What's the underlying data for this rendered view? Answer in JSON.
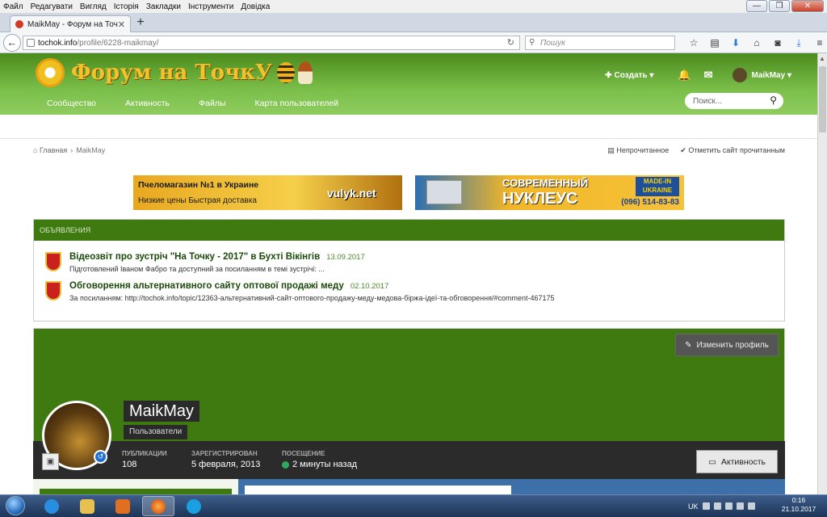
{
  "menubar": {
    "items": [
      "Файл",
      "Редагувати",
      "Вигляд",
      "Історія",
      "Закладки",
      "Інструменти",
      "Довідка"
    ]
  },
  "browser": {
    "tab_title": "MaikMay - Форум на ТочкУ",
    "url_domain": "tochok.info",
    "url_path": "/profile/6228-maikmay/",
    "search_placeholder": "Пошук"
  },
  "site": {
    "logo_text": "Форум на ТочкУ",
    "create_label": "Создать",
    "user_name": "MaikMay",
    "nav": [
      "Сообщество",
      "Активность",
      "Файлы",
      "Карта пользователей"
    ],
    "search_placeholder": "Поиск..."
  },
  "breadcrumb": {
    "home": "Главная",
    "current": "MaikMay",
    "unread": "Непрочитанное",
    "mark_read": "Отметить сайт прочитанным"
  },
  "banners": {
    "left_line1": "Пчеломагазин №1 в Украине",
    "left_line2": "Низкие цены    Быстрая доставка",
    "left_brand": "vulyk.net",
    "right_line1": "СОВРЕМЕННЫЙ",
    "right_line2": "НУКЛЕУС",
    "right_badge": "MADE-IN UKRAINE",
    "right_phone": "(096) 514-83-83"
  },
  "announcements": {
    "header": "Объявления",
    "items": [
      {
        "title": "Відеозвіт про зустріч \"На Точку - 2017\" в Бухті Вікінгів",
        "date": "13.09.2017",
        "snippet": "Підготовлений Іваном Фабро та доступний за посиланням в темі зустрічі:  ..."
      },
      {
        "title": "Обговорення альтернативного сайту оптової продажі меду",
        "date": "02.10.2017",
        "snippet": "За посиланням:  http://tochok.info/topic/12363-альтернативний-сайт-оптового-продажу-меду-медова-біржа-ідеї-та-обговорення/#comment-467175"
      }
    ]
  },
  "profile": {
    "edit_label": "Изменить профиль",
    "name": "MaikMay",
    "group": "Пользователи",
    "stats": [
      {
        "label": "Публикации",
        "value": "108"
      },
      {
        "label": "Зарегистрирован",
        "value": "5 февраля, 2013"
      },
      {
        "label": "Посещение",
        "value": "2 минуты назад"
      }
    ],
    "activity_label": "Активность"
  },
  "taskbar": {
    "lang": "UK",
    "time": "0:16",
    "date": "21.10.2017"
  },
  "colors": {
    "site_green": "#3f7a10",
    "header_green": "#7bbf4a",
    "online_dot": "#2fa860"
  }
}
